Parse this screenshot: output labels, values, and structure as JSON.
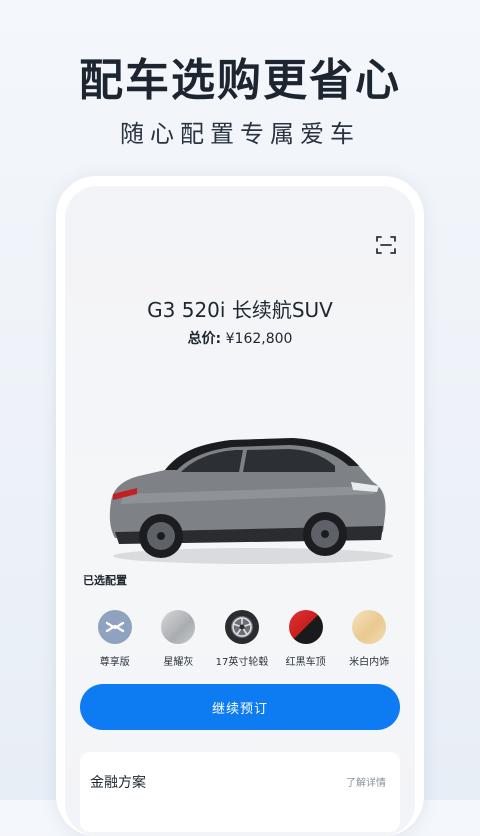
{
  "hero": {
    "title": "配车选购更省心",
    "subtitle": "随心配置专属爱车"
  },
  "car": {
    "name": "G3 520i 长续航SUV",
    "price_label": "总价:",
    "price_value": "¥162,800"
  },
  "config": {
    "section_title": "已选配置",
    "items": [
      {
        "label": "尊享版",
        "icon": "trim-logo-icon",
        "color": "#8fa2bf"
      },
      {
        "label": "星耀灰",
        "icon": "paint-swatch-icon",
        "color": "#b9bcc0"
      },
      {
        "label": "17英寸轮毂",
        "icon": "wheel-icon",
        "color": "#2a2c30"
      },
      {
        "label": "红黑车顶",
        "icon": "roof-color-icon",
        "color": "#d22a2a"
      },
      {
        "label": "米白内饰",
        "icon": "interior-swatch-icon",
        "color": "#f0d6a6"
      }
    ]
  },
  "cta": {
    "label": "继续预订"
  },
  "finance": {
    "title": "金融方案",
    "link": "了解详情"
  },
  "colors": {
    "accent": "#0d7bf2"
  }
}
